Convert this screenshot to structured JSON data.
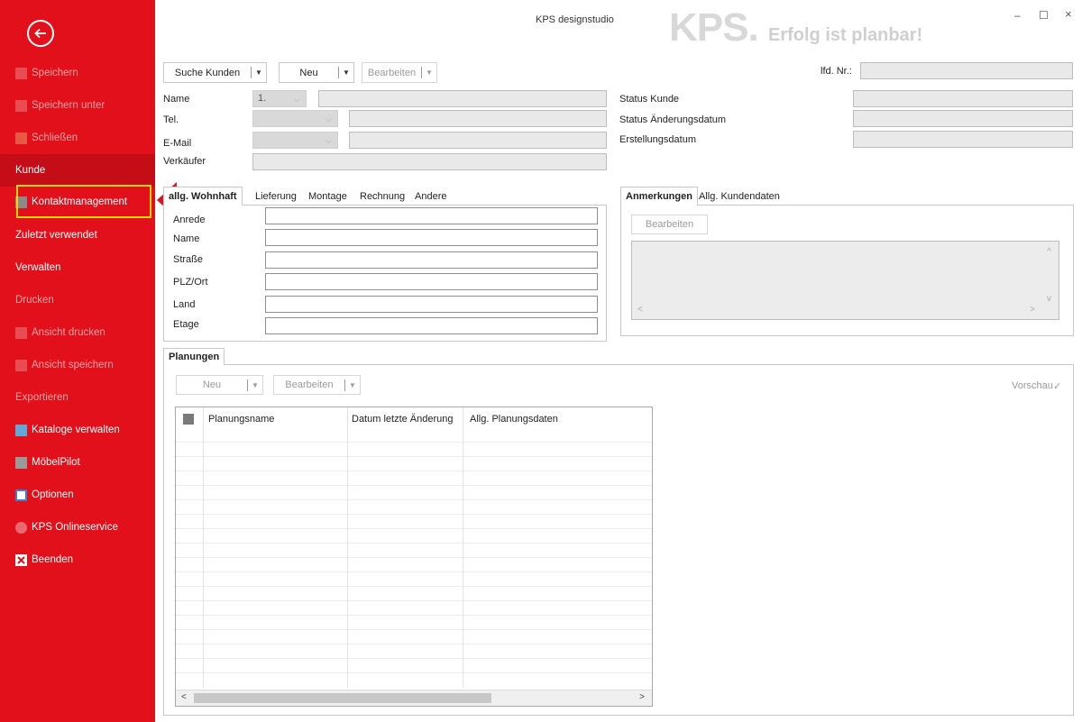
{
  "window": {
    "title": "KPS designstudio",
    "logo": "KPS.",
    "slogan": "Erfolg ist planbar!",
    "minimize": "–",
    "maximize": "☐",
    "close": "×"
  },
  "sidebar": {
    "items": [
      {
        "label": "Speichern",
        "icon": "save-icon"
      },
      {
        "label": "Speichern unter",
        "icon": "save-as-icon"
      },
      {
        "label": "Schließen",
        "icon": "folder-icon"
      },
      {
        "label": "Kunde"
      },
      {
        "label": "Kontaktmanagement",
        "icon": "contact-icon"
      },
      {
        "label": "Zuletzt verwendet"
      },
      {
        "label": "Verwalten"
      },
      {
        "label": "Drucken"
      },
      {
        "label": "Ansicht drucken",
        "icon": "print-icon"
      },
      {
        "label": "Ansicht speichern",
        "icon": "save-view-icon"
      },
      {
        "label": "Exportieren"
      },
      {
        "label": "Kataloge verwalten",
        "icon": "catalog-icon"
      },
      {
        "label": "MöbelPilot",
        "icon": "moebelpilot-icon"
      },
      {
        "label": "Optionen",
        "icon": "options-icon"
      },
      {
        "label": "KPS Onlineservice",
        "icon": "globe-icon"
      },
      {
        "label": "Beenden",
        "icon": "exit-icon"
      }
    ]
  },
  "toolbar": {
    "search_label": "Suche Kunden",
    "new_label": "Neu",
    "edit_label": "Bearbeiten",
    "lfd_label": "lfd. Nr.:"
  },
  "customer": {
    "name_label": "Name",
    "name_combo": "1.",
    "tel_label": "Tel.",
    "email_label": "E-Mail",
    "seller_label": "Verkäufer",
    "status_label": "Status Kunde",
    "status_date_label": "Status Änderungsdatum",
    "created_label": "Erstellungsdatum"
  },
  "address_tabs": {
    "tabs": [
      "allg. Wohnhaft",
      "Lieferung",
      "Montage",
      "Rechnung",
      "Andere"
    ],
    "fields": [
      "Anrede",
      "Name",
      "Straße",
      "PLZ/Ort",
      "Land",
      "Etage"
    ]
  },
  "notes": {
    "tabs": [
      "Anmerkungen",
      "Allg. Kundendaten"
    ],
    "edit_label": "Bearbeiten"
  },
  "plannings": {
    "tab_label": "Planungen",
    "new_label": "Neu",
    "edit_label": "Bearbeiten",
    "preview_label": "Vorschau",
    "preview_check": "✓",
    "columns": [
      "Planungsname",
      "Datum letzte Änderung",
      "Allg. Planungsdaten"
    ]
  },
  "colors": {
    "brand": "#e1101a",
    "highlight": "#f5d800"
  }
}
